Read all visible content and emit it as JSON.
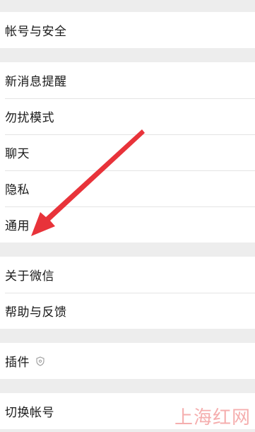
{
  "settings": {
    "account_security": "帐号与安全",
    "new_message_notify": "新消息提醒",
    "do_not_disturb": "勿扰模式",
    "chat": "聊天",
    "privacy": "隐私",
    "general": "通用",
    "about_wechat": "关于微信",
    "help_feedback": "帮助与反馈",
    "plugins": "插件",
    "switch_account": "切换帐号"
  },
  "watermark": {
    "text": "上海红网"
  },
  "colors": {
    "arrow": "#e8333a",
    "background": "#ededed",
    "row": "#ffffff"
  }
}
